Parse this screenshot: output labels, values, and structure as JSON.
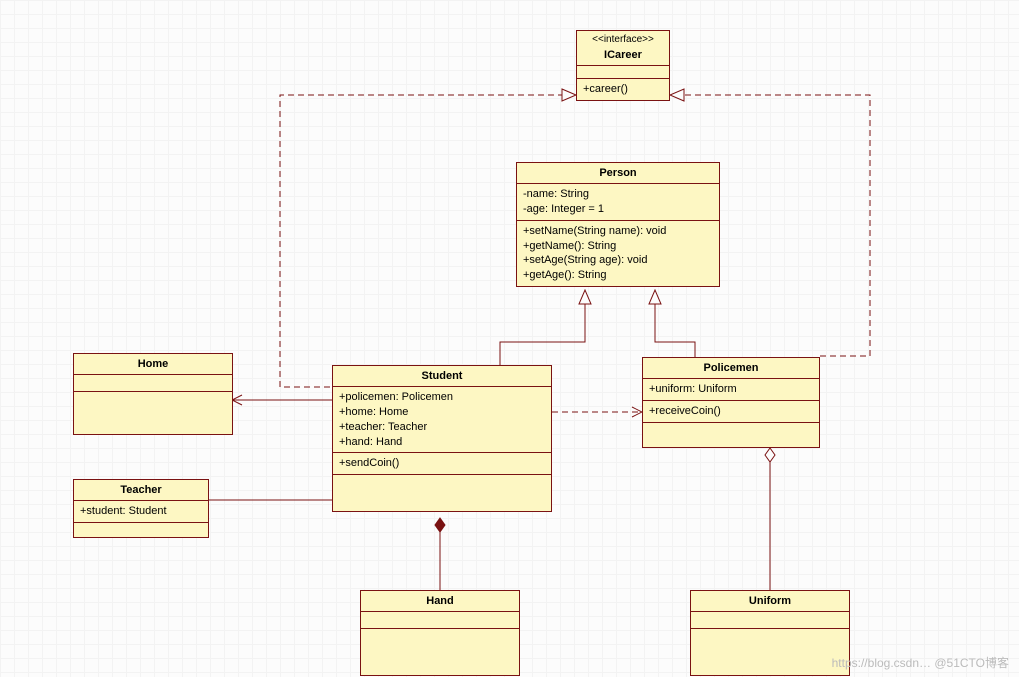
{
  "diagram_type": "UML Class Diagram",
  "watermark": "https://blog.csdn…  @51CTO博客",
  "classes": {
    "icareer": {
      "stereotype": "<<interface>>",
      "name": "ICareer",
      "attributes": [],
      "operations": [
        "+career()"
      ]
    },
    "person": {
      "name": "Person",
      "attributes": [
        "-name: String",
        "-age: Integer = 1"
      ],
      "operations": [
        "+setName(String name): void",
        "+getName(): String",
        "+setAge(String age): void",
        "+getAge(): String"
      ]
    },
    "home": {
      "name": "Home",
      "attributes": [],
      "operations": []
    },
    "teacher": {
      "name": "Teacher",
      "attributes": [
        "+student: Student"
      ],
      "operations": []
    },
    "student": {
      "name": "Student",
      "attributes": [
        "+policemen: Policemen",
        "+home: Home",
        "+teacher: Teacher",
        "+hand: Hand"
      ],
      "operations": [
        "+sendCoin()"
      ]
    },
    "policemen": {
      "name": "Policemen",
      "attributes": [
        "+uniform: Uniform"
      ],
      "operations": [
        "+receiveCoin()"
      ]
    },
    "hand": {
      "name": "Hand",
      "attributes": [],
      "operations": []
    },
    "uniform": {
      "name": "Uniform",
      "attributes": [],
      "operations": []
    }
  },
  "relationships": [
    {
      "from": "Student",
      "to": "ICareer",
      "type": "realization"
    },
    {
      "from": "Policemen",
      "to": "ICareer",
      "type": "realization"
    },
    {
      "from": "Student",
      "to": "Person",
      "type": "generalization"
    },
    {
      "from": "Policemen",
      "to": "Person",
      "type": "generalization"
    },
    {
      "from": "Student",
      "to": "Home",
      "type": "association-arrow"
    },
    {
      "from": "Teacher",
      "to": "Student",
      "type": "association"
    },
    {
      "from": "Student",
      "to": "Hand",
      "type": "composition"
    },
    {
      "from": "Student",
      "to": "Policemen",
      "type": "dependency"
    },
    {
      "from": "Policemen",
      "to": "Uniform",
      "type": "aggregation"
    }
  ]
}
